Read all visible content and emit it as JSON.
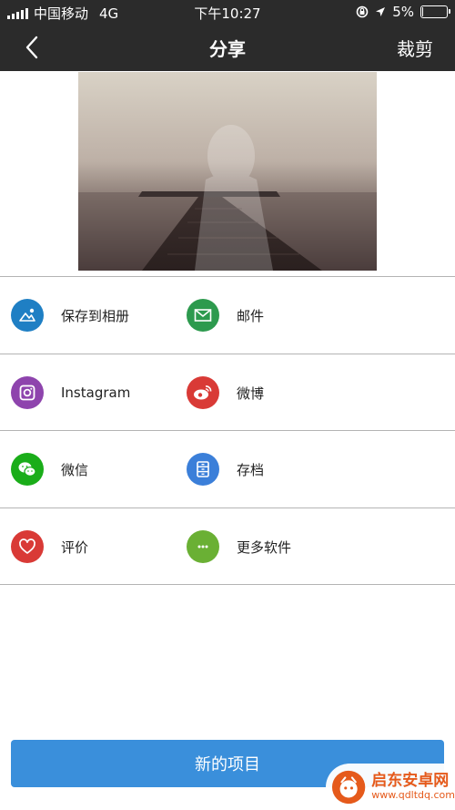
{
  "status_bar": {
    "carrier": "中国移动",
    "network": "4G",
    "time": "下午10:27",
    "battery_text": "5%",
    "battery_level": 0.05
  },
  "nav": {
    "title": "分享",
    "right_action": "裁剪"
  },
  "share_options": [
    {
      "label": "保存到相册",
      "icon": "photo-album-icon",
      "color": "#1f7fc4"
    },
    {
      "label": "邮件",
      "icon": "mail-icon",
      "color": "#2d9a4e"
    },
    {
      "label": "Instagram",
      "icon": "instagram-icon",
      "color": "#8e44ad"
    },
    {
      "label": "微博",
      "icon": "weibo-icon",
      "color": "#d93a36"
    },
    {
      "label": "微信",
      "icon": "wechat-icon",
      "color": "#1aad19"
    },
    {
      "label": "存档",
      "icon": "archive-icon",
      "color": "#3b7fd9"
    },
    {
      "label": "评价",
      "icon": "heart-icon",
      "color": "#d93a36"
    },
    {
      "label": "更多软件",
      "icon": "more-icon",
      "color": "#6ab034"
    }
  ],
  "primary_button": {
    "label": "新的项目"
  },
  "watermark": {
    "brand": "启东安卓网",
    "url": "www.qdltdq.com"
  }
}
